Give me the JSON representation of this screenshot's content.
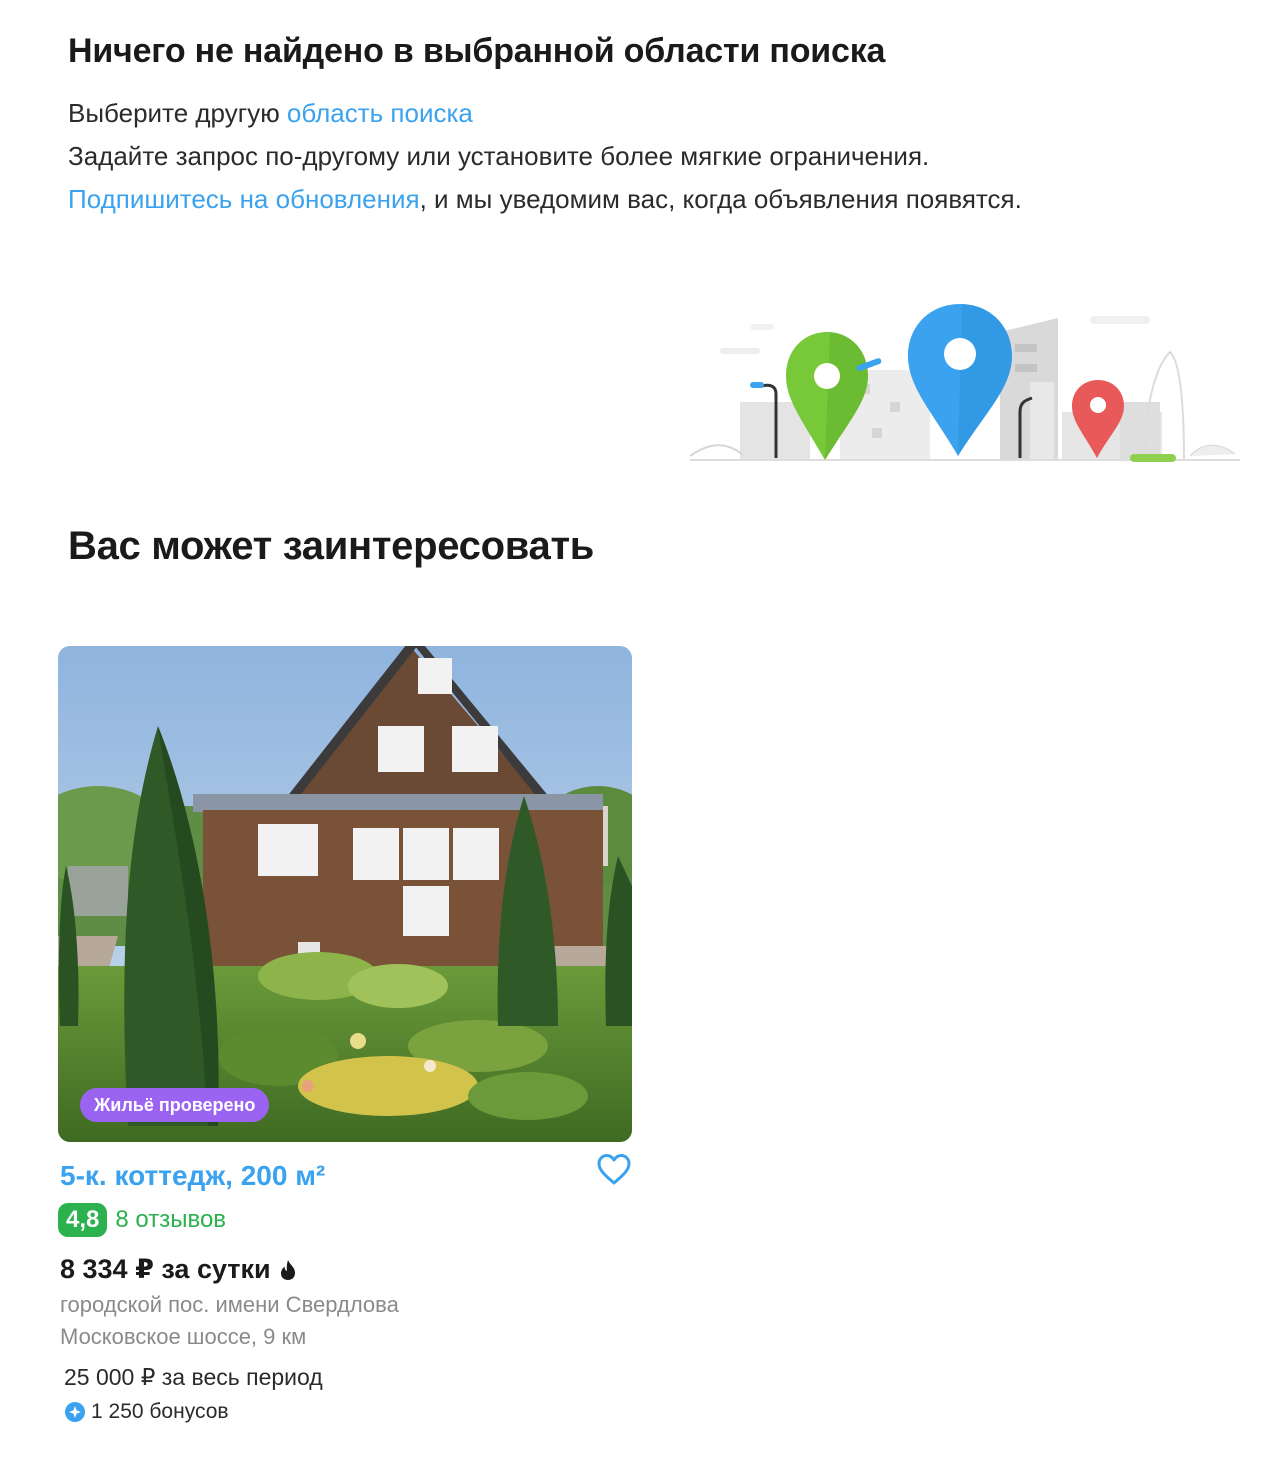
{
  "empty_state": {
    "title": "Ничего не найдено в выбранной области поиска",
    "line1_prefix": "Выберите другую ",
    "line1_link": "область поиска",
    "line2": "Задайте запрос по-другому или установите более мягкие ограничения.",
    "line3_link": "Подпишитесь на обновления",
    "line3_suffix": ", и мы уведомим вас, когда объявления появятся."
  },
  "recommendations": {
    "title": "Вас может заинтересовать"
  },
  "card": {
    "badge": "Жильё проверено",
    "title": "5-к. коттедж, 200 м²",
    "rating": "4,8",
    "reviews": "8 отзывов",
    "price": "8 334 ₽ за сутки",
    "locality": "городской пос. имени Свердлова",
    "highway": "Московское шоссе, 9 км",
    "total_price": "25 000 ₽ за весь период",
    "bonus": "1 250 бонусов"
  },
  "colors": {
    "link": "#3aa2ee",
    "rating_green": "#2bb14d",
    "badge_purple": "#9b63f2"
  },
  "icons": {
    "favorite": "heart-icon",
    "price_hint": "fire-icon",
    "bonus": "bonus-icon"
  }
}
